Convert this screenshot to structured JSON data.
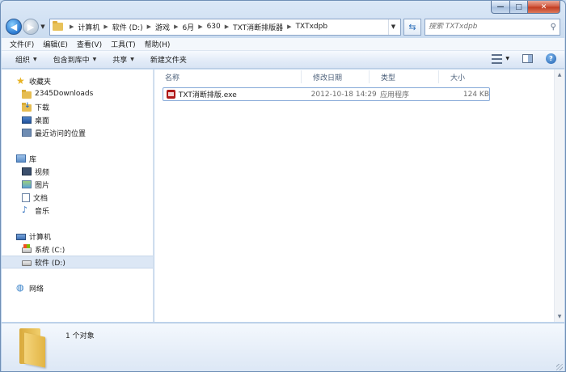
{
  "window": {
    "caption": {
      "minimize": "—",
      "maximize": "□",
      "close": "✕"
    }
  },
  "address": {
    "breadcrumbs": [
      "计算机",
      "软件 (D:)",
      "游戏",
      "6月",
      "630",
      "TXT消断排版器",
      "TXTxdpb"
    ]
  },
  "search": {
    "placeholder": "搜索 TXTxdpb"
  },
  "menu": [
    "文件(F)",
    "编辑(E)",
    "查看(V)",
    "工具(T)",
    "帮助(H)"
  ],
  "commands": {
    "organize": "组织",
    "include_in_library": "包含到库中",
    "share": "共享",
    "new_folder": "新建文件夹"
  },
  "nav": {
    "favorites": {
      "label": "收藏夹",
      "items": [
        "2345Downloads",
        "下载",
        "桌面",
        "最近访问的位置"
      ]
    },
    "libraries": {
      "label": "库",
      "items": [
        "视频",
        "图片",
        "文档",
        "音乐"
      ]
    },
    "computer": {
      "label": "计算机",
      "items": [
        "系统 (C:)",
        "软件 (D:)"
      ],
      "selected": "软件 (D:)"
    },
    "network": {
      "label": "网络"
    }
  },
  "columns": {
    "name": "名称",
    "date": "修改日期",
    "type": "类型",
    "size": "大小"
  },
  "files": [
    {
      "name": "TXT消断排版.exe",
      "date": "2012-10-18 14:29",
      "type": "应用程序",
      "size": "124 KB"
    }
  ],
  "details": {
    "count": "1 个对象"
  }
}
